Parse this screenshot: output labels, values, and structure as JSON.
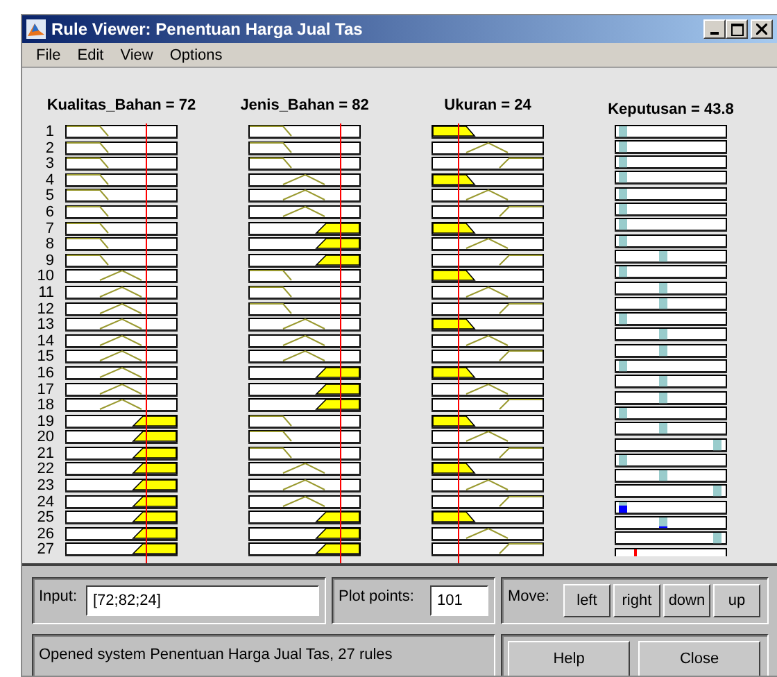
{
  "window": {
    "title": "Rule Viewer: Penentuan Harga Jual Tas"
  },
  "menu": [
    "File",
    "Edit",
    "View",
    "Options"
  ],
  "inputs": [
    {
      "label": "Kualitas_Bahan = 72"
    },
    {
      "label": "Jenis_Bahan = 82"
    },
    {
      "label": "Ukuran = 24"
    }
  ],
  "output": {
    "label": "Keputusan = 43.8"
  },
  "rules": [
    {
      "number": "1",
      "terms": [
        {
          "kind": "low",
          "fired": false
        },
        {
          "kind": "low",
          "fired": false
        },
        {
          "kind": "low",
          "fired": true
        }
      ],
      "output": {
        "kind": "low",
        "fired": false
      }
    },
    {
      "number": "2",
      "terms": [
        {
          "kind": "low",
          "fired": false
        },
        {
          "kind": "low",
          "fired": false
        },
        {
          "kind": "mid",
          "fired": false
        }
      ],
      "output": {
        "kind": "low",
        "fired": false
      }
    },
    {
      "number": "3",
      "terms": [
        {
          "kind": "low",
          "fired": false
        },
        {
          "kind": "low",
          "fired": false
        },
        {
          "kind": "high",
          "fired": false
        }
      ],
      "output": {
        "kind": "low",
        "fired": false
      }
    },
    {
      "number": "4",
      "terms": [
        {
          "kind": "low",
          "fired": false
        },
        {
          "kind": "mid",
          "fired": false
        },
        {
          "kind": "low",
          "fired": true
        }
      ],
      "output": {
        "kind": "low",
        "fired": false
      }
    },
    {
      "number": "5",
      "terms": [
        {
          "kind": "low",
          "fired": false
        },
        {
          "kind": "mid",
          "fired": false
        },
        {
          "kind": "mid",
          "fired": false
        }
      ],
      "output": {
        "kind": "low",
        "fired": false
      }
    },
    {
      "number": "6",
      "terms": [
        {
          "kind": "low",
          "fired": false
        },
        {
          "kind": "mid",
          "fired": false
        },
        {
          "kind": "high",
          "fired": false
        }
      ],
      "output": {
        "kind": "low",
        "fired": false
      }
    },
    {
      "number": "7",
      "terms": [
        {
          "kind": "low",
          "fired": false
        },
        {
          "kind": "high",
          "fired": true
        },
        {
          "kind": "low",
          "fired": true
        }
      ],
      "output": {
        "kind": "low",
        "fired": false
      }
    },
    {
      "number": "8",
      "terms": [
        {
          "kind": "low",
          "fired": false
        },
        {
          "kind": "high",
          "fired": true
        },
        {
          "kind": "mid",
          "fired": false
        }
      ],
      "output": {
        "kind": "low",
        "fired": false
      }
    },
    {
      "number": "9",
      "terms": [
        {
          "kind": "low",
          "fired": false
        },
        {
          "kind": "high",
          "fired": true
        },
        {
          "kind": "high",
          "fired": false
        }
      ],
      "output": {
        "kind": "mid",
        "fired": false
      }
    },
    {
      "number": "10",
      "terms": [
        {
          "kind": "mid",
          "fired": false
        },
        {
          "kind": "low",
          "fired": false
        },
        {
          "kind": "low",
          "fired": true
        }
      ],
      "output": {
        "kind": "low",
        "fired": false
      }
    },
    {
      "number": "11",
      "terms": [
        {
          "kind": "mid",
          "fired": false
        },
        {
          "kind": "low",
          "fired": false
        },
        {
          "kind": "mid",
          "fired": false
        }
      ],
      "output": {
        "kind": "mid",
        "fired": false
      }
    },
    {
      "number": "12",
      "terms": [
        {
          "kind": "mid",
          "fired": false
        },
        {
          "kind": "low",
          "fired": false
        },
        {
          "kind": "high",
          "fired": false
        }
      ],
      "output": {
        "kind": "mid",
        "fired": false
      }
    },
    {
      "number": "13",
      "terms": [
        {
          "kind": "mid",
          "fired": false
        },
        {
          "kind": "mid",
          "fired": false
        },
        {
          "kind": "low",
          "fired": true
        }
      ],
      "output": {
        "kind": "low",
        "fired": false
      }
    },
    {
      "number": "14",
      "terms": [
        {
          "kind": "mid",
          "fired": false
        },
        {
          "kind": "mid",
          "fired": false
        },
        {
          "kind": "mid",
          "fired": false
        }
      ],
      "output": {
        "kind": "mid",
        "fired": false
      }
    },
    {
      "number": "15",
      "terms": [
        {
          "kind": "mid",
          "fired": false
        },
        {
          "kind": "mid",
          "fired": false
        },
        {
          "kind": "high",
          "fired": false
        }
      ],
      "output": {
        "kind": "mid",
        "fired": false
      }
    },
    {
      "number": "16",
      "terms": [
        {
          "kind": "mid",
          "fired": false
        },
        {
          "kind": "high",
          "fired": true
        },
        {
          "kind": "low",
          "fired": true
        }
      ],
      "output": {
        "kind": "low",
        "fired": false
      }
    },
    {
      "number": "17",
      "terms": [
        {
          "kind": "mid",
          "fired": false
        },
        {
          "kind": "high",
          "fired": true
        },
        {
          "kind": "mid",
          "fired": false
        }
      ],
      "output": {
        "kind": "mid",
        "fired": false
      }
    },
    {
      "number": "18",
      "terms": [
        {
          "kind": "mid",
          "fired": false
        },
        {
          "kind": "high",
          "fired": true
        },
        {
          "kind": "high",
          "fired": false
        }
      ],
      "output": {
        "kind": "mid",
        "fired": false
      }
    },
    {
      "number": "19",
      "terms": [
        {
          "kind": "high",
          "fired": true
        },
        {
          "kind": "low",
          "fired": false
        },
        {
          "kind": "low",
          "fired": true
        }
      ],
      "output": {
        "kind": "low",
        "fired": false
      }
    },
    {
      "number": "20",
      "terms": [
        {
          "kind": "high",
          "fired": true
        },
        {
          "kind": "low",
          "fired": false
        },
        {
          "kind": "mid",
          "fired": false
        }
      ],
      "output": {
        "kind": "mid",
        "fired": false
      }
    },
    {
      "number": "21",
      "terms": [
        {
          "kind": "high",
          "fired": true
        },
        {
          "kind": "low",
          "fired": false
        },
        {
          "kind": "high",
          "fired": false
        }
      ],
      "output": {
        "kind": "high",
        "fired": false
      }
    },
    {
      "number": "22",
      "terms": [
        {
          "kind": "high",
          "fired": true
        },
        {
          "kind": "mid",
          "fired": false
        },
        {
          "kind": "low",
          "fired": true
        }
      ],
      "output": {
        "kind": "low",
        "fired": false
      }
    },
    {
      "number": "23",
      "terms": [
        {
          "kind": "high",
          "fired": true
        },
        {
          "kind": "mid",
          "fired": false
        },
        {
          "kind": "mid",
          "fired": false
        }
      ],
      "output": {
        "kind": "mid",
        "fired": false
      }
    },
    {
      "number": "24",
      "terms": [
        {
          "kind": "high",
          "fired": true
        },
        {
          "kind": "mid",
          "fired": false
        },
        {
          "kind": "high",
          "fired": false
        }
      ],
      "output": {
        "kind": "high",
        "fired": false
      }
    },
    {
      "number": "25",
      "terms": [
        {
          "kind": "high",
          "fired": true
        },
        {
          "kind": "high",
          "fired": true
        },
        {
          "kind": "low",
          "fired": true
        }
      ],
      "output": {
        "kind": "low",
        "fired": true,
        "full": true
      }
    },
    {
      "number": "26",
      "terms": [
        {
          "kind": "high",
          "fired": true
        },
        {
          "kind": "high",
          "fired": true
        },
        {
          "kind": "mid",
          "fired": false
        }
      ],
      "output": {
        "kind": "mid",
        "fired": true,
        "full": false
      }
    },
    {
      "number": "27",
      "terms": [
        {
          "kind": "high",
          "fired": true
        },
        {
          "kind": "high",
          "fired": true
        },
        {
          "kind": "high",
          "fired": false
        }
      ],
      "output": {
        "kind": "high",
        "fired": false
      }
    }
  ],
  "controls": {
    "input_label": "Input:",
    "input_value": "[72;82;24]",
    "plot_points_label": "Plot points:",
    "plot_points_value": "101",
    "move_label": "Move:",
    "move_buttons": [
      "left",
      "right",
      "down",
      "up"
    ],
    "status": "Opened system Penentuan Harga Jual Tas, 27 rules",
    "buttons": [
      "Help",
      "Close"
    ]
  }
}
